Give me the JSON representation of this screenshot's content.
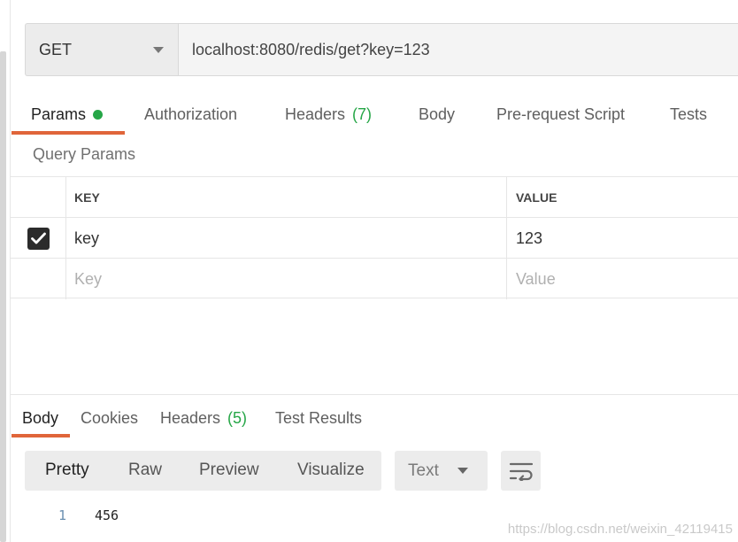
{
  "request": {
    "method": "GET",
    "url": "localhost:8080/redis/get?key=123"
  },
  "request_tabs": [
    {
      "label": "Params",
      "active": true,
      "has_dot": true
    },
    {
      "label": "Authorization"
    },
    {
      "label": "Headers",
      "count": "(7)"
    },
    {
      "label": "Body"
    },
    {
      "label": "Pre-request Script"
    },
    {
      "label": "Tests"
    }
  ],
  "query_params": {
    "title": "Query Params",
    "headers": {
      "key": "KEY",
      "value": "VALUE"
    },
    "rows": [
      {
        "checked": true,
        "key": "key",
        "value": "123"
      }
    ],
    "new_row": {
      "key_placeholder": "Key",
      "value_placeholder": "Value"
    }
  },
  "response_tabs": [
    {
      "label": "Body",
      "active": true
    },
    {
      "label": "Cookies"
    },
    {
      "label": "Headers",
      "count": "(5)"
    },
    {
      "label": "Test Results"
    }
  ],
  "view_modes": [
    "Pretty",
    "Raw",
    "Preview",
    "Visualize"
  ],
  "format": "Text",
  "response_body": [
    {
      "line": "1",
      "text": "456"
    }
  ],
  "watermark": "https://blog.csdn.net/weixin_42119415",
  "colors": {
    "accent": "#e0653a",
    "green": "#26a647"
  }
}
